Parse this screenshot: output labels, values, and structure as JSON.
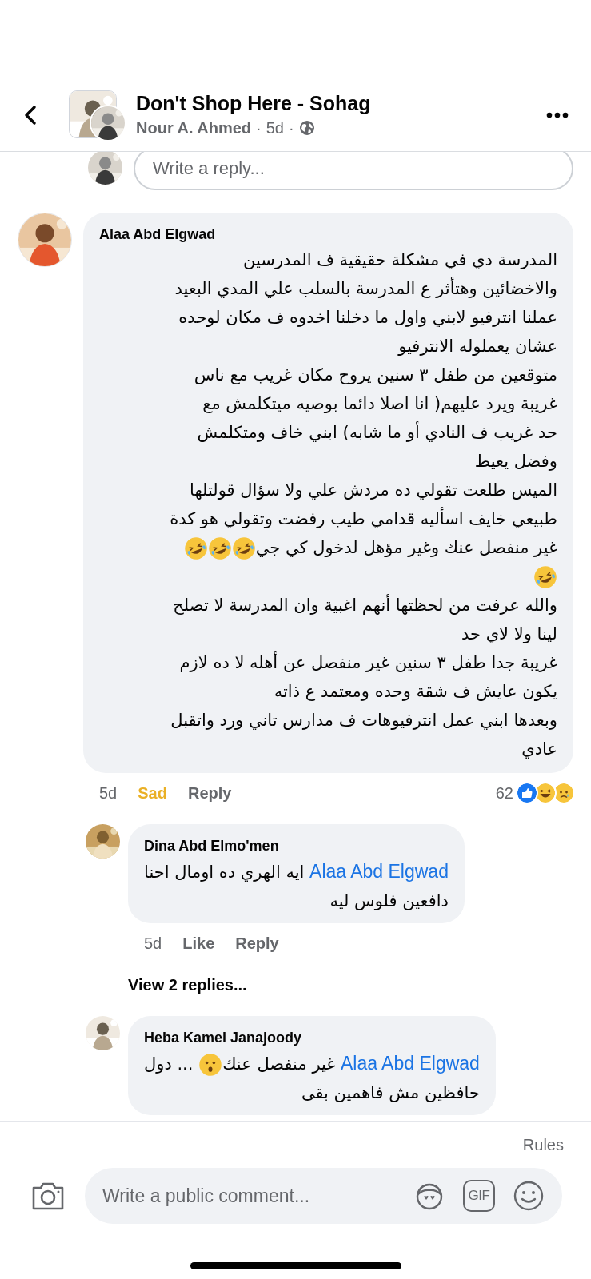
{
  "header": {
    "title": "Don't Shop Here - Sohag",
    "author": "Nour A. Ahmed",
    "separator_1": "·",
    "time": "5d",
    "separator_2": "·",
    "page_avatar": {
      "kind": "picture"
    },
    "author_avatar": {
      "kind": "picture"
    }
  },
  "reply_box": {
    "placeholder": "Write a reply...",
    "avatar": {
      "kind": "picture"
    }
  },
  "comment": {
    "name": "Alaa Abd Elgwad",
    "avatar": {
      "kind": "picture"
    },
    "lines": [
      [
        {
          "kind": "text",
          "text": "المدرسة دي في مشكلة حقيقية ف المدرسين"
        }
      ],
      [
        {
          "kind": "text",
          "text": "والاخضائين وهتأثر ع المدرسة بالسلب علي المدي البعيد"
        }
      ],
      [
        {
          "kind": "text",
          "text": "عملنا انترفيو لابني واول ما دخلنا اخدوه ف مكان لوحده"
        }
      ],
      [
        {
          "kind": "text",
          "text": "عشان يعملوله الانترفيو"
        }
      ],
      [
        {
          "kind": "text",
          "text": "متوقعين من طفل ٣ سنين يروح مكان غريب مع ناس"
        }
      ],
      [
        {
          "kind": "text",
          "text": "غريبة ويرد عليهم( انا اصلا دائما بوصيه ميتكلمش مع"
        }
      ],
      [
        {
          "kind": "text",
          "text": "حد غريب ف النادي أو ما شابه) ابني خاف ومتكلمش"
        }
      ],
      [
        {
          "kind": "text",
          "text": "وفضل يعيط"
        }
      ],
      [
        {
          "kind": "text",
          "text": "الميس طلعت تقولي ده مردش علي ولا سؤال قولتلها"
        }
      ],
      [
        {
          "kind": "text",
          "text": "طبيعي خايف اسأليه قدامي طيب رفضت وتقولي هو كدة"
        }
      ],
      [
        {
          "kind": "text",
          "text": "غير منفصل عنك وغير مؤهل لدخول كي جي"
        },
        {
          "kind": "laughing_emoji"
        },
        {
          "kind": "laughing_emoji"
        },
        {
          "kind": "laughing_emoji"
        }
      ],
      [
        {
          "kind": "laughing_emoji"
        }
      ],
      [
        {
          "kind": "text",
          "text": "والله عرفت من لحظتها أنهم اغبية وان المدرسة لا تصلح"
        }
      ],
      [
        {
          "kind": "text",
          "text": "لينا ولا لاي حد"
        }
      ],
      [
        {
          "kind": "text",
          "text": "غريبة جدا طفل ٣ سنين غير منفصل عن أهله لا ده لازم"
        }
      ],
      [
        {
          "kind": "text",
          "text": "يكون عايش ف شقة وحده ومعتمد ع ذاته"
        }
      ],
      [
        {
          "kind": "text",
          "text": "وبعدها ابني عمل انترفيوهات ف مدارس تاني ورد واتقبل"
        }
      ],
      [
        {
          "kind": "text",
          "text": "عادي"
        }
      ]
    ],
    "time": "5d",
    "my_reaction": "Sad",
    "reply": "Reply",
    "reaction_count": "62",
    "reactions": [
      {
        "kind": "like"
      },
      {
        "kind": "haha"
      },
      {
        "kind": "sad"
      }
    ]
  },
  "replies": [
    {
      "name": "Dina Abd Elmo'men",
      "avatar": {
        "kind": "picture"
      },
      "lines": [
        [
          {
            "kind": "mention",
            "text": "Alaa Abd Elgwad"
          },
          {
            "kind": "text",
            "text": " ايه الهري ده اومال احنا"
          }
        ],
        [
          {
            "kind": "text",
            "text": "دافعين فلوس ليه"
          }
        ]
      ],
      "time": "5d",
      "like": "Like",
      "reply": "Reply",
      "view_replies": "View 2 replies..."
    },
    {
      "name": "Heba Kamel Janajoody",
      "avatar": {
        "kind": "picture"
      },
      "lines": [
        [
          {
            "kind": "mention",
            "text": "Alaa Abd Elgwad"
          },
          {
            "kind": "text",
            "text": " غير منفصل عنك"
          },
          {
            "kind": "surprised_emoji"
          },
          {
            "kind": "text",
            "text": " ... دول"
          }
        ],
        [
          {
            "kind": "text",
            "text": "حافظين مش فاهمين بقى"
          }
        ]
      ]
    }
  ],
  "footer": {
    "rules": "Rules",
    "placeholder": "Write a public comment...",
    "gif": "GIF"
  }
}
